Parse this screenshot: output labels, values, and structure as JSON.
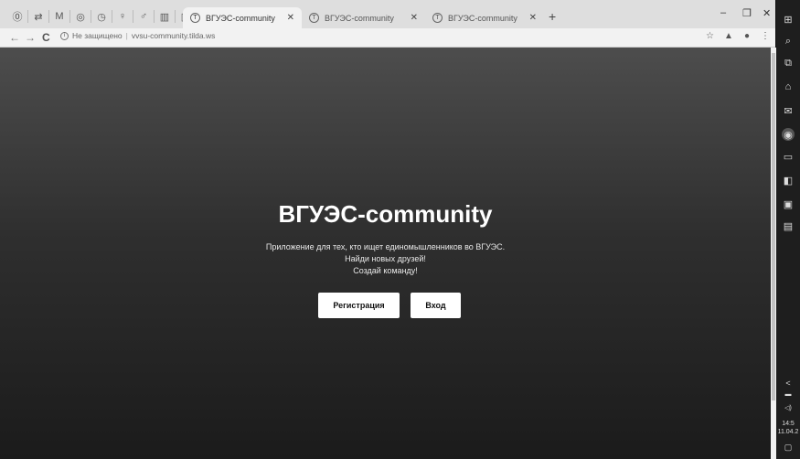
{
  "browser": {
    "pinned_icons": [
      "tilda-icon",
      "translate-icon",
      "gmail-icon",
      "chrome-icon",
      "history-icon",
      "person-icon",
      "person-icon",
      "chart-icon",
      "window-icon"
    ],
    "tabs": [
      {
        "title": "ВГУЭС-community",
        "active": true
      },
      {
        "title": "ВГУЭС-community",
        "active": false
      },
      {
        "title": "ВГУЭС-community",
        "active": false
      }
    ],
    "new_tab": "+",
    "window_controls": {
      "minimize": "–",
      "maximize": "❐",
      "close": "✕"
    },
    "nav": {
      "back": "←",
      "forward": "→",
      "reload": "C"
    },
    "address": {
      "security": "Не защищено",
      "url": "vvsu-community.tilda.ws"
    }
  },
  "hero": {
    "title": "ВГУЭС-community",
    "lines": [
      "Приложение для тех, кто ищет единомышленников во ВГУЭС.",
      "Найди новых друзей!",
      "Создай команду!"
    ],
    "buttons": {
      "register": "Регистрация",
      "login": "Вход"
    }
  },
  "taskbar": {
    "time": "14:5",
    "date": "11.04.2",
    "chevron": "<"
  }
}
